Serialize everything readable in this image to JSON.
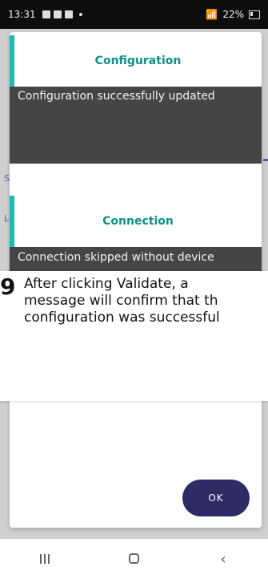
{
  "status_bar": {
    "time": "13:31",
    "battery": "22%"
  },
  "bg": {
    "letter_s": "S",
    "letter_l": "L"
  },
  "steps": [
    {
      "title": "Configuration",
      "message": "Configuration successfully updated"
    },
    {
      "title": "Connection",
      "message": "Connection skipped without device"
    }
  ],
  "caption": {
    "number": "9",
    "lines": [
      "After clicking Validate, a",
      "message will confirm that th",
      "configuration was successful"
    ]
  },
  "ok_button": {
    "label": "OK"
  },
  "colors": {
    "accent_teal": "#1bbcb1",
    "title_teal": "#0f8f8a",
    "toast_bg": "#454545",
    "ok_bg": "#2e2a63"
  }
}
